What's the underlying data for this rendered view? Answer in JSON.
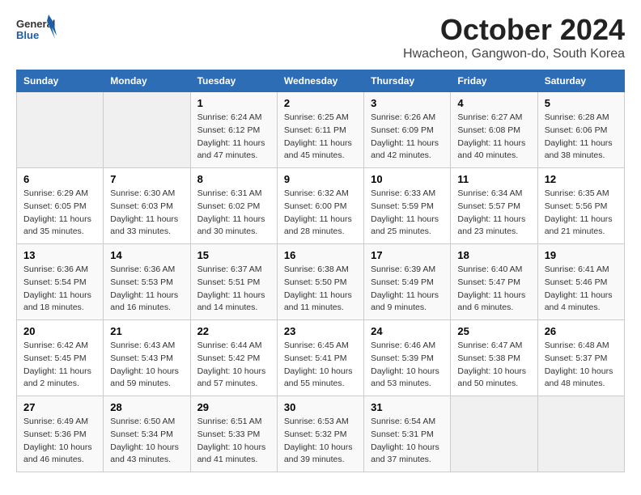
{
  "header": {
    "logo_general": "General",
    "logo_blue": "Blue",
    "main_title": "October 2024",
    "subtitle": "Hwacheon, Gangwon-do, South Korea"
  },
  "columns": [
    "Sunday",
    "Monday",
    "Tuesday",
    "Wednesday",
    "Thursday",
    "Friday",
    "Saturday"
  ],
  "weeks": [
    [
      {
        "day": "",
        "details": ""
      },
      {
        "day": "",
        "details": ""
      },
      {
        "day": "1",
        "details": "Sunrise: 6:24 AM\nSunset: 6:12 PM\nDaylight: 11 hours\nand 47 minutes."
      },
      {
        "day": "2",
        "details": "Sunrise: 6:25 AM\nSunset: 6:11 PM\nDaylight: 11 hours\nand 45 minutes."
      },
      {
        "day": "3",
        "details": "Sunrise: 6:26 AM\nSunset: 6:09 PM\nDaylight: 11 hours\nand 42 minutes."
      },
      {
        "day": "4",
        "details": "Sunrise: 6:27 AM\nSunset: 6:08 PM\nDaylight: 11 hours\nand 40 minutes."
      },
      {
        "day": "5",
        "details": "Sunrise: 6:28 AM\nSunset: 6:06 PM\nDaylight: 11 hours\nand 38 minutes."
      }
    ],
    [
      {
        "day": "6",
        "details": "Sunrise: 6:29 AM\nSunset: 6:05 PM\nDaylight: 11 hours\nand 35 minutes."
      },
      {
        "day": "7",
        "details": "Sunrise: 6:30 AM\nSunset: 6:03 PM\nDaylight: 11 hours\nand 33 minutes."
      },
      {
        "day": "8",
        "details": "Sunrise: 6:31 AM\nSunset: 6:02 PM\nDaylight: 11 hours\nand 30 minutes."
      },
      {
        "day": "9",
        "details": "Sunrise: 6:32 AM\nSunset: 6:00 PM\nDaylight: 11 hours\nand 28 minutes."
      },
      {
        "day": "10",
        "details": "Sunrise: 6:33 AM\nSunset: 5:59 PM\nDaylight: 11 hours\nand 25 minutes."
      },
      {
        "day": "11",
        "details": "Sunrise: 6:34 AM\nSunset: 5:57 PM\nDaylight: 11 hours\nand 23 minutes."
      },
      {
        "day": "12",
        "details": "Sunrise: 6:35 AM\nSunset: 5:56 PM\nDaylight: 11 hours\nand 21 minutes."
      }
    ],
    [
      {
        "day": "13",
        "details": "Sunrise: 6:36 AM\nSunset: 5:54 PM\nDaylight: 11 hours\nand 18 minutes."
      },
      {
        "day": "14",
        "details": "Sunrise: 6:36 AM\nSunset: 5:53 PM\nDaylight: 11 hours\nand 16 minutes."
      },
      {
        "day": "15",
        "details": "Sunrise: 6:37 AM\nSunset: 5:51 PM\nDaylight: 11 hours\nand 14 minutes."
      },
      {
        "day": "16",
        "details": "Sunrise: 6:38 AM\nSunset: 5:50 PM\nDaylight: 11 hours\nand 11 minutes."
      },
      {
        "day": "17",
        "details": "Sunrise: 6:39 AM\nSunset: 5:49 PM\nDaylight: 11 hours\nand 9 minutes."
      },
      {
        "day": "18",
        "details": "Sunrise: 6:40 AM\nSunset: 5:47 PM\nDaylight: 11 hours\nand 6 minutes."
      },
      {
        "day": "19",
        "details": "Sunrise: 6:41 AM\nSunset: 5:46 PM\nDaylight: 11 hours\nand 4 minutes."
      }
    ],
    [
      {
        "day": "20",
        "details": "Sunrise: 6:42 AM\nSunset: 5:45 PM\nDaylight: 11 hours\nand 2 minutes."
      },
      {
        "day": "21",
        "details": "Sunrise: 6:43 AM\nSunset: 5:43 PM\nDaylight: 10 hours\nand 59 minutes."
      },
      {
        "day": "22",
        "details": "Sunrise: 6:44 AM\nSunset: 5:42 PM\nDaylight: 10 hours\nand 57 minutes."
      },
      {
        "day": "23",
        "details": "Sunrise: 6:45 AM\nSunset: 5:41 PM\nDaylight: 10 hours\nand 55 minutes."
      },
      {
        "day": "24",
        "details": "Sunrise: 6:46 AM\nSunset: 5:39 PM\nDaylight: 10 hours\nand 53 minutes."
      },
      {
        "day": "25",
        "details": "Sunrise: 6:47 AM\nSunset: 5:38 PM\nDaylight: 10 hours\nand 50 minutes."
      },
      {
        "day": "26",
        "details": "Sunrise: 6:48 AM\nSunset: 5:37 PM\nDaylight: 10 hours\nand 48 minutes."
      }
    ],
    [
      {
        "day": "27",
        "details": "Sunrise: 6:49 AM\nSunset: 5:36 PM\nDaylight: 10 hours\nand 46 minutes."
      },
      {
        "day": "28",
        "details": "Sunrise: 6:50 AM\nSunset: 5:34 PM\nDaylight: 10 hours\nand 43 minutes."
      },
      {
        "day": "29",
        "details": "Sunrise: 6:51 AM\nSunset: 5:33 PM\nDaylight: 10 hours\nand 41 minutes."
      },
      {
        "day": "30",
        "details": "Sunrise: 6:53 AM\nSunset: 5:32 PM\nDaylight: 10 hours\nand 39 minutes."
      },
      {
        "day": "31",
        "details": "Sunrise: 6:54 AM\nSunset: 5:31 PM\nDaylight: 10 hours\nand 37 minutes."
      },
      {
        "day": "",
        "details": ""
      },
      {
        "day": "",
        "details": ""
      }
    ]
  ]
}
